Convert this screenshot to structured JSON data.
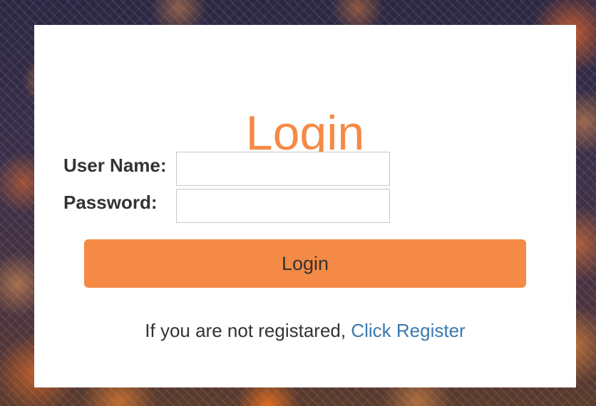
{
  "login_form": {
    "title": "Login",
    "username_label": "User Name:",
    "username_value": "",
    "password_label": "Password:",
    "password_value": "",
    "submit_label": "Login",
    "register_prompt": "If you are not registared,",
    "register_link": "Click Register"
  },
  "colors": {
    "accent": "#f48a45",
    "link": "#3a78b0",
    "text": "#333333",
    "card_background": "#ffffff"
  },
  "background": {
    "kind": "night-city-photo"
  }
}
